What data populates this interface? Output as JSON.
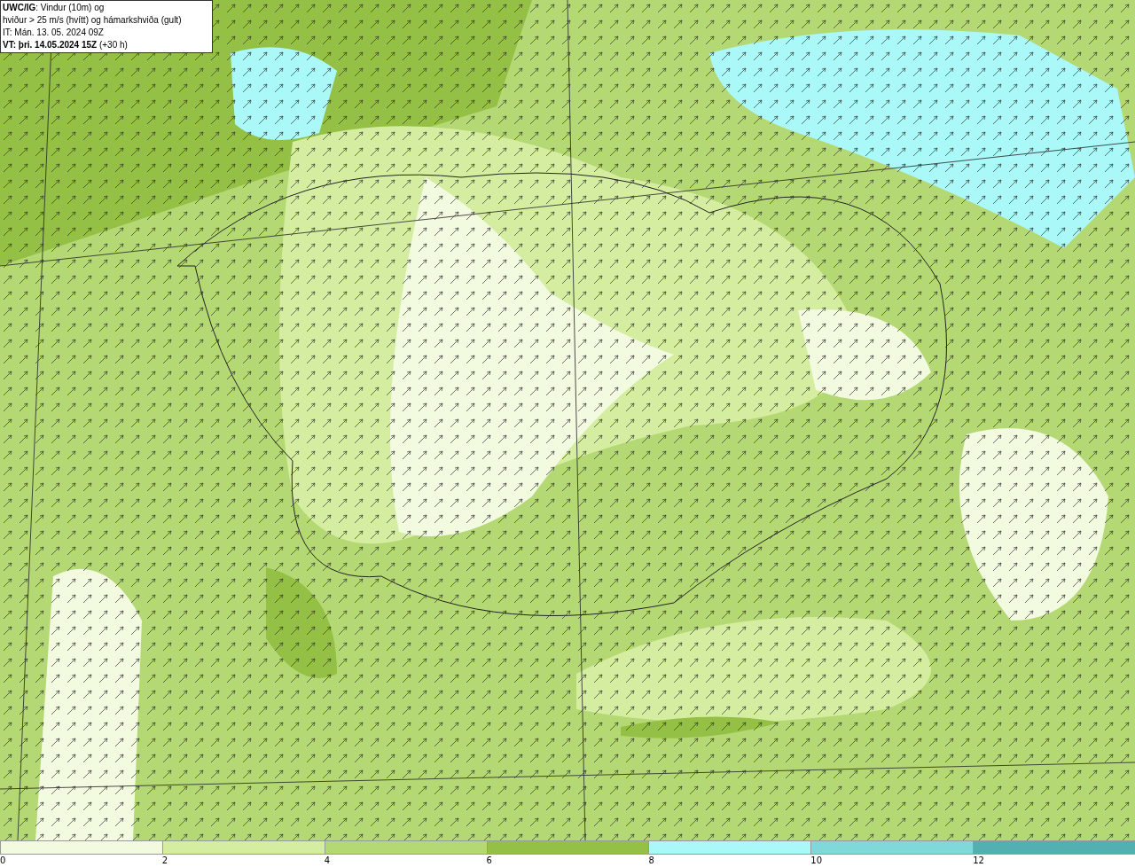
{
  "header": {
    "lines": [
      "**UWC/IG**: Vindur (10m) og",
      "hviður > 25 m/s (hvítt) og hámarkshviða (gult)",
      "IT: Mán. 13. 05. 2024 09Z",
      "**VT: þri. 14.05.2024 15Z** (+30 h)"
    ]
  },
  "legend": [
    {
      "color": "#f2fadf",
      "label": "0"
    },
    {
      "color": "#d4eda0",
      "label": "2"
    },
    {
      "color": "#b4d873",
      "label": "4"
    },
    {
      "color": "#94c045",
      "label": "6"
    },
    {
      "color": "#aaf8f8",
      "label": "8"
    },
    {
      "color": "#80d8d8",
      "label": "10"
    },
    {
      "color": "#52b0b0",
      "label": "12"
    }
  ]
}
